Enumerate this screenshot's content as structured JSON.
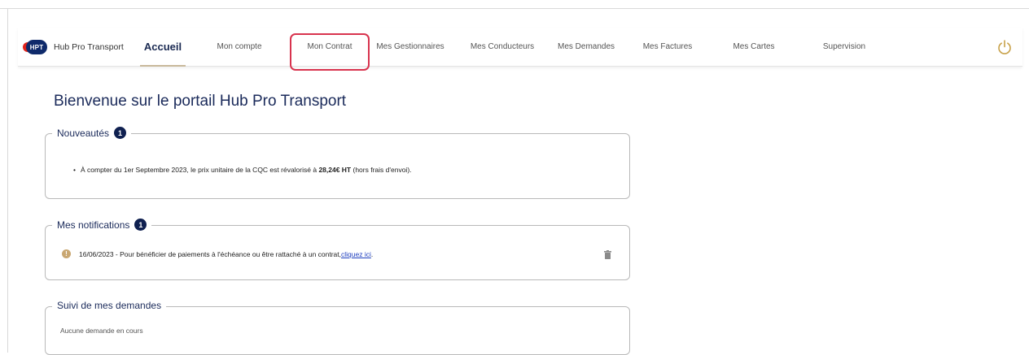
{
  "brand": {
    "logo_text": "HPT",
    "name": "Hub Pro Transport",
    "colors": {
      "navy": "#0f2a6b",
      "red": "#e2231a",
      "accent": "#c8b89a"
    }
  },
  "nav": {
    "items": [
      {
        "label": "Accueil"
      },
      {
        "label": "Mon compte"
      },
      {
        "label": "Mon Contrat"
      },
      {
        "label": "Mes Gestionnaires"
      },
      {
        "label": "Mes Conducteurs"
      },
      {
        "label": "Mes Demandes"
      },
      {
        "label": "Mes Factures"
      },
      {
        "label": "Mes Cartes"
      },
      {
        "label": "Supervision"
      }
    ],
    "active": "Accueil",
    "highlighted": "Mon Contrat",
    "power_icon": "power-icon"
  },
  "main": {
    "title": "Bienvenue sur le portail Hub Pro Transport",
    "news": {
      "legend": "Nouveautés",
      "count": "1",
      "bullet": "•",
      "text_before": "À compter du 1er Septembre 2023, le prix unitaire de la CQC est révalorisé à ",
      "text_bold": "28,24€ HT",
      "text_after": " (hors frais d'envoi)."
    },
    "notifications": {
      "legend": "Mes notifications",
      "count": "1",
      "item": {
        "icon": "warning-icon",
        "icon_glyph": "!",
        "text": "16/06/2023 - Pour bénéficier de paiements à l'échéance ou être rattaché à un contrat, ",
        "link": "cliquez ici",
        "suffix": " ."
      }
    },
    "requests": {
      "legend": "Suivi de mes demandes",
      "empty_text": "Aucune demande en cours"
    }
  }
}
